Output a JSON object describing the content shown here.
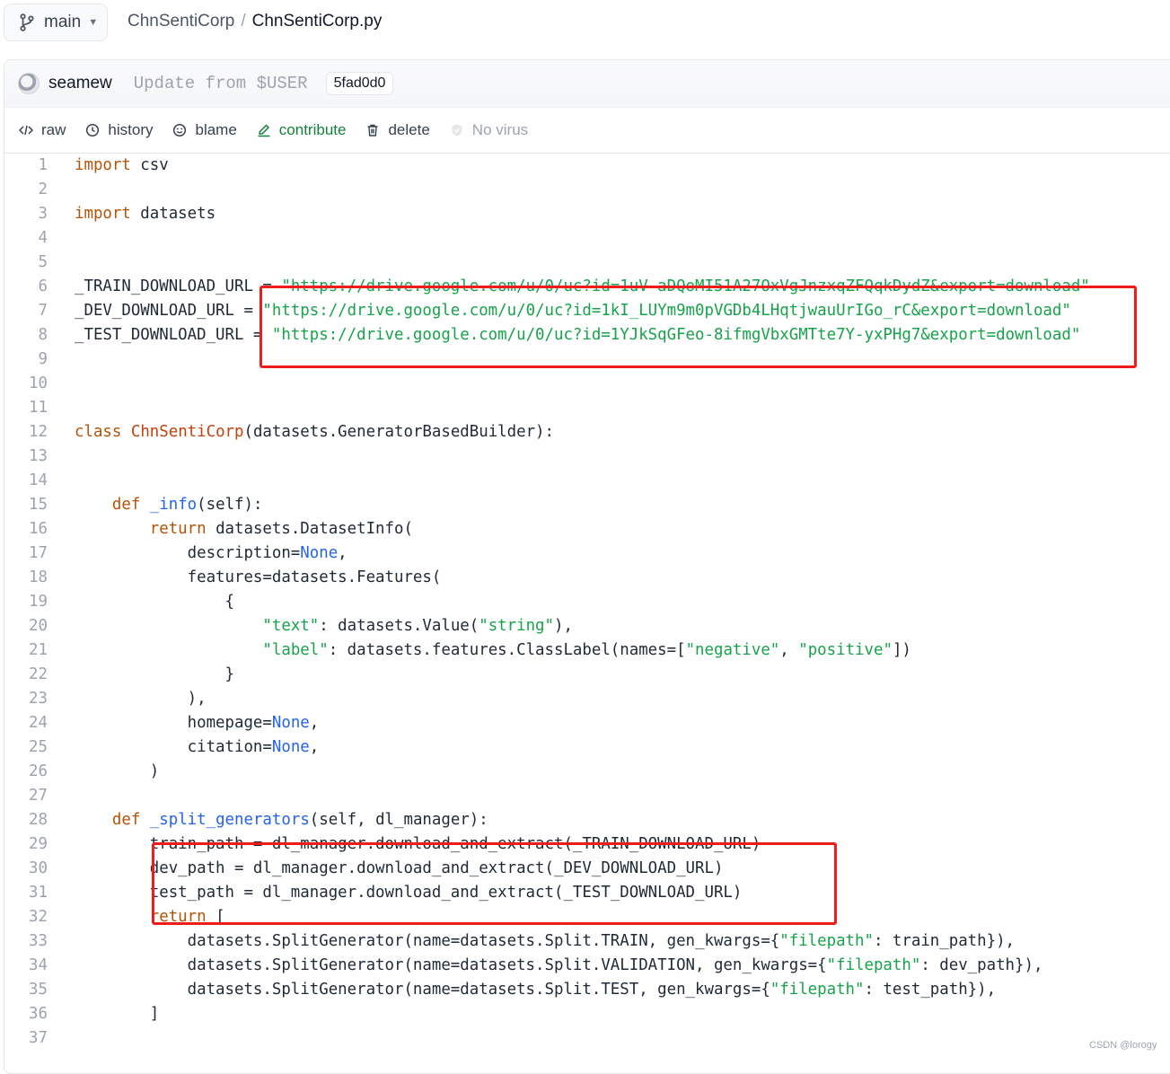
{
  "branch": {
    "label": "main"
  },
  "breadcrumb": {
    "repo": "ChnSentiCorp",
    "separator": "/",
    "file": "ChnSentiCorp.py"
  },
  "commit": {
    "author": "seamew",
    "message": "Update from $USER",
    "sha": "5fad0d0"
  },
  "actions": {
    "raw": "raw",
    "history": "history",
    "blame": "blame",
    "contribute": "contribute",
    "delete": "delete",
    "no_virus": "No virus"
  },
  "code_lines": [
    "import csv",
    "",
    "import datasets",
    "",
    "",
    "_TRAIN_DOWNLOAD_URL = \"https://drive.google.com/u/0/uc?id=1uV-aDQoMI51A27OxVgJnzxqZFQqkDydZ&export=download\"",
    "_DEV_DOWNLOAD_URL = \"https://drive.google.com/u/0/uc?id=1kI_LUYm9m0pVGDb4LHqtjwauUrIGo_rC&export=download\"",
    "_TEST_DOWNLOAD_URL = \"https://drive.google.com/u/0/uc?id=1YJkSqGFeo-8ifmgVbxGMTte7Y-yxPHg7&export=download\"",
    "",
    "",
    "",
    "class ChnSentiCorp(datasets.GeneratorBasedBuilder):",
    "",
    "",
    "    def _info(self):",
    "        return datasets.DatasetInfo(",
    "            description=None,",
    "            features=datasets.Features(",
    "                {",
    "                    \"text\": datasets.Value(\"string\"),",
    "                    \"label\": datasets.features.ClassLabel(names=[\"negative\", \"positive\"])",
    "                }",
    "            ),",
    "            homepage=None,",
    "            citation=None,",
    "        )",
    "",
    "    def _split_generators(self, dl_manager):",
    "        train_path = dl_manager.download_and_extract(_TRAIN_DOWNLOAD_URL)",
    "        dev_path = dl_manager.download_and_extract(_DEV_DOWNLOAD_URL)",
    "        test_path = dl_manager.download_and_extract(_TEST_DOWNLOAD_URL)",
    "        return [",
    "            datasets.SplitGenerator(name=datasets.Split.TRAIN, gen_kwargs={\"filepath\": train_path}),",
    "            datasets.SplitGenerator(name=datasets.Split.VALIDATION, gen_kwargs={\"filepath\": dev_path}),",
    "            datasets.SplitGenerator(name=datasets.Split.TEST, gen_kwargs={\"filepath\": test_path}),",
    "        ]",
    ""
  ],
  "highlight_color": "#ef1c1c",
  "icons": [
    "branch-icon",
    "code-icon",
    "clock-icon",
    "smiley-icon",
    "pencil-icon",
    "trash-icon",
    "shield-check-icon"
  ],
  "watermark": "CSDN @lorogy"
}
